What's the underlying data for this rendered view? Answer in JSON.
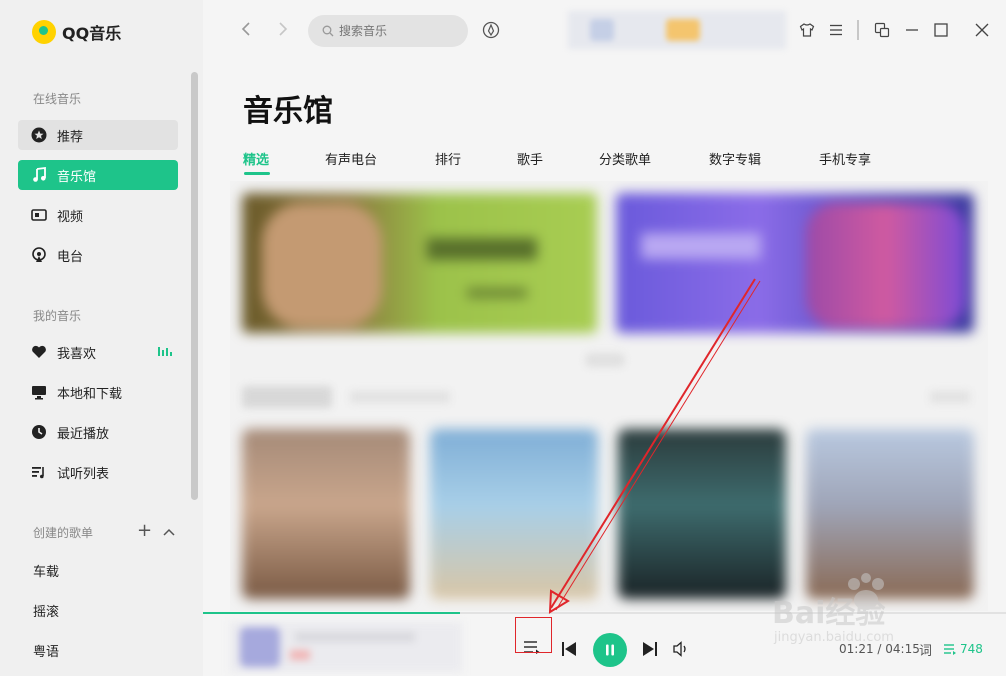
{
  "app": {
    "name": "QQ音乐"
  },
  "sidebar": {
    "online_title": "在线音乐",
    "online_items": [
      {
        "label": "推荐",
        "icon": "star-icon",
        "state": "hover"
      },
      {
        "label": "音乐馆",
        "icon": "music-note-icon",
        "state": "selected"
      },
      {
        "label": "视频",
        "icon": "video-icon",
        "state": "normal"
      },
      {
        "label": "电台",
        "icon": "radio-icon",
        "state": "normal"
      }
    ],
    "my_title": "我的音乐",
    "my_items": [
      {
        "label": "我喜欢",
        "icon": "heart-icon"
      },
      {
        "label": "本地和下载",
        "icon": "computer-icon"
      },
      {
        "label": "最近播放",
        "icon": "clock-icon"
      },
      {
        "label": "试听列表",
        "icon": "playlist-icon"
      }
    ],
    "created_title": "创建的歌单",
    "playlists": [
      "车载",
      "摇滚",
      "粤语"
    ]
  },
  "topbar": {
    "search_placeholder": "搜索音乐"
  },
  "main": {
    "title": "音乐馆",
    "tabs": [
      "精选",
      "有声电台",
      "排行",
      "歌手",
      "分类歌单",
      "数字专辑",
      "手机专享"
    ],
    "active_tab": "精选"
  },
  "player": {
    "progress": 0.32,
    "time": "01:21 / 04:15",
    "lyric_label": "词",
    "playlist_count": "748"
  },
  "colors": {
    "accent": "#1ec48a",
    "annotation": "#e0262b"
  },
  "watermark": {
    "brand": "Bai经验",
    "url": "jingyan.baidu.com"
  }
}
